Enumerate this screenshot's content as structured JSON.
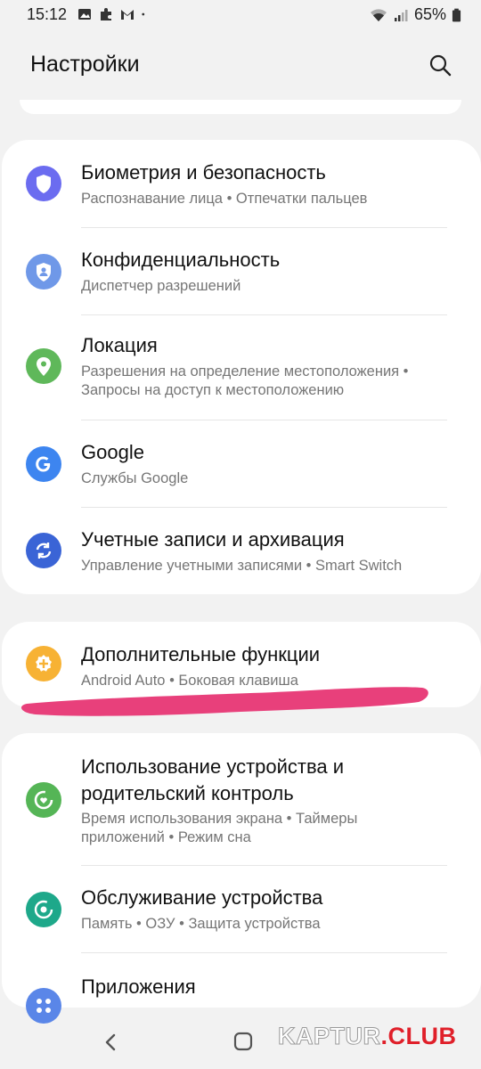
{
  "status": {
    "time": "15:12",
    "battery": "65%"
  },
  "header": {
    "title": "Настройки"
  },
  "sections": [
    {
      "items": [
        {
          "title": "Биометрия и безопасность",
          "subtitle": "Распознавание лица  •  Отпечатки пальцев",
          "icon": "shield-icon",
          "color": "#6b6cf0"
        },
        {
          "title": "Конфиденциальность",
          "subtitle": "Диспетчер разрешений",
          "icon": "privacy-shield-icon",
          "color": "#6f98e8"
        },
        {
          "title": "Локация",
          "subtitle_lines": [
            "Разрешения на определение местоположения  •",
            "Запросы на доступ к местоположению"
          ],
          "icon": "location-pin-icon",
          "color": "#5fb85a"
        },
        {
          "title": "Google",
          "subtitle": "Службы Google",
          "icon": "google-g-icon",
          "color": "#3d85f0"
        },
        {
          "title": "Учетные записи и архивация",
          "subtitle": "Управление учетными записями  •  Smart Switch",
          "icon": "sync-icon",
          "color": "#3a64d6"
        }
      ]
    },
    {
      "items": [
        {
          "title": "Дополнительные функции",
          "subtitle": "Android Auto  •  Боковая клавиша",
          "icon": "plus-gear-icon",
          "color": "#f7b234"
        }
      ]
    },
    {
      "items": [
        {
          "title_lines": [
            "Использование устройства и",
            "родительский контроль"
          ],
          "subtitle_lines": [
            "Время использования экрана  •  Таймеры",
            "приложений  •  Режим сна"
          ],
          "icon": "digital-wellbeing-icon",
          "color": "#55b556"
        },
        {
          "title": "Обслуживание устройства",
          "subtitle": "Память  •  ОЗУ  •  Защита устройства",
          "icon": "device-care-icon",
          "color": "#1ea88a"
        },
        {
          "title": "Приложения",
          "icon": "apps-icon",
          "color": "#5a86e8"
        }
      ]
    }
  ],
  "annotation": {
    "highlight_color": "#e8407b"
  },
  "watermark": {
    "part1": "KAPTUR",
    "part2": ".CLUB"
  }
}
